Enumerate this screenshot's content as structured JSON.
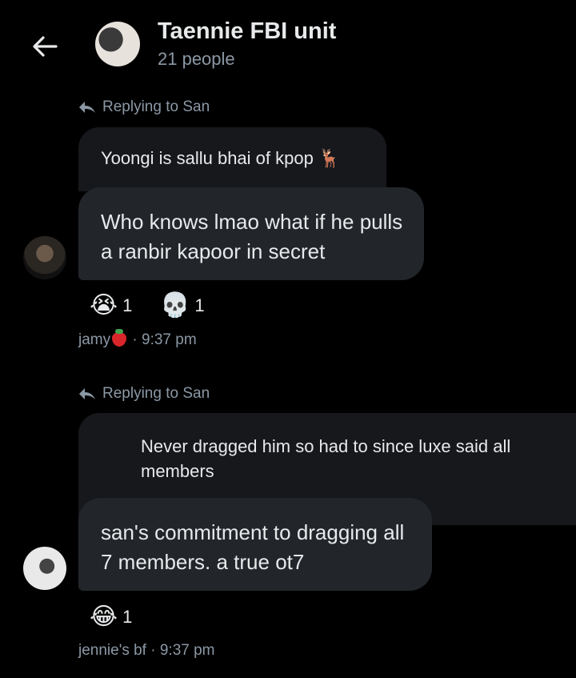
{
  "header": {
    "title": "Taennie FBI unit",
    "subtitle": "21 people",
    "back_icon": "arrow-left-icon"
  },
  "messages": [
    {
      "replying_to": "Replying to San",
      "quoted_text": "Yoongi is sallu bhai of kpop 🦌",
      "text": "Who knows lmao what  if he pulls a ranbir kapoor in secret",
      "reactions": [
        {
          "emoji": "😭",
          "count": "1"
        },
        {
          "emoji": "💀",
          "count": "1"
        }
      ],
      "sender": "jamy",
      "time": "· 9:37 pm"
    },
    {
      "replying_to": "Replying to San",
      "quoted_text": "Never dragged him so had to since luxe said all members",
      "text": "san's commitment to dragging all 7 members. a true ot7",
      "reactions": [
        {
          "emoji": "😂",
          "count": "1"
        }
      ],
      "sender": "jennie's bf",
      "time": "· 9:37 pm"
    }
  ]
}
